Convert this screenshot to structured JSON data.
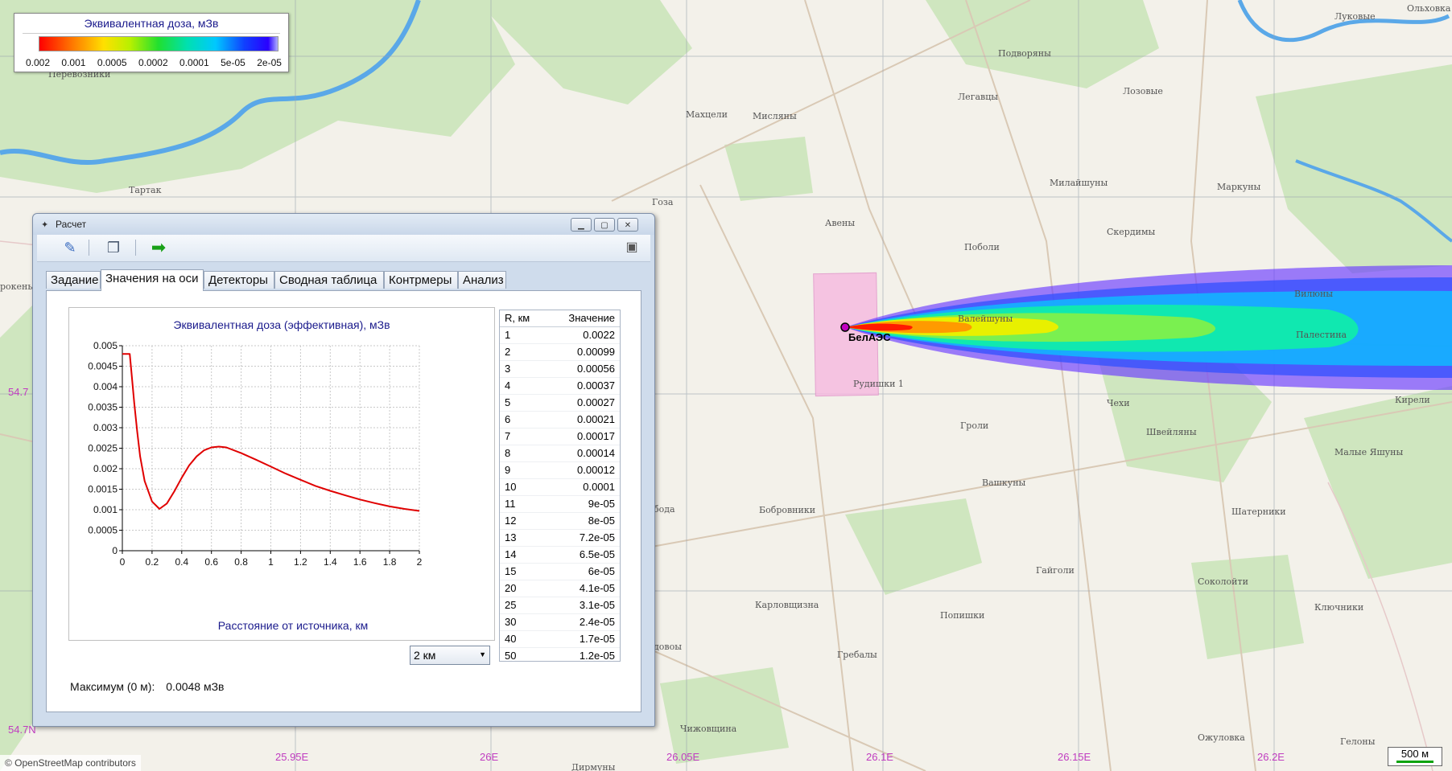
{
  "legend": {
    "title": "Эквивалентная доза, мЗв",
    "ticks": [
      "0.002",
      "0.001",
      "0.0005",
      "0.0002",
      "0.0001",
      "5e-05",
      "2e-05"
    ]
  },
  "map": {
    "source_label": "БелАЭС",
    "place_labels": [
      {
        "id": "podvoryany",
        "text": "Подворяны"
      },
      {
        "id": "lukovye",
        "text": "Луковые"
      },
      {
        "id": "olkovka",
        "text": "Ольховка"
      },
      {
        "id": "perevoznyki",
        "text": "Перевозники"
      },
      {
        "id": "mahcely",
        "text": "Махцели"
      },
      {
        "id": "mislyany",
        "text": "Мисляны"
      },
      {
        "id": "legavtsy",
        "text": "Легавцы"
      },
      {
        "id": "lozovye",
        "text": "Лозовые"
      },
      {
        "id": "milaishuny",
        "text": "Милайшуны"
      },
      {
        "id": "markuny",
        "text": "Маркуны"
      },
      {
        "id": "tartak",
        "text": "Тартак"
      },
      {
        "id": "goza",
        "text": "Гоза"
      },
      {
        "id": "aveny",
        "text": "Авены"
      },
      {
        "id": "poboli",
        "text": "Поболи"
      },
      {
        "id": "skerdimy",
        "text": "Скердимы"
      },
      {
        "id": "valeishuny",
        "text": "Валейшуны"
      },
      {
        "id": "vilnyuny",
        "text": "Вилюны"
      },
      {
        "id": "palestina",
        "text": "Палестина"
      },
      {
        "id": "rudishki",
        "text": "Рудишки 1"
      },
      {
        "id": "chehi",
        "text": "Чехи"
      },
      {
        "id": "groli",
        "text": "Гроли"
      },
      {
        "id": "shveilyany",
        "text": "Швейляны"
      },
      {
        "id": "kireli",
        "text": "Кирели"
      },
      {
        "id": "malye_yashuny",
        "text": "Малые Яшуны"
      },
      {
        "id": "vashkuny",
        "text": "Вашкуны"
      },
      {
        "id": "bobrovniki",
        "text": "Бобровники"
      },
      {
        "id": "shaterniki",
        "text": "Шатерники"
      },
      {
        "id": "gaigoli",
        "text": "Гайголи"
      },
      {
        "id": "sokoloity",
        "text": "Соколойти"
      },
      {
        "id": "karlovichizna",
        "text": "Карловщизна"
      },
      {
        "id": "popishki",
        "text": "Попишки"
      },
      {
        "id": "klyuchniki",
        "text": "Ключники"
      },
      {
        "id": "grebaly",
        "text": "Гребалы"
      },
      {
        "id": "chizhovshchina",
        "text": "Чижовщина"
      },
      {
        "id": "ozhulovka",
        "text": "Ожуловка"
      },
      {
        "id": "gelony",
        "text": "Гелоны"
      },
      {
        "id": "dirmuny",
        "text": "Дирмуны"
      },
      {
        "id": "rokenye",
        "text": "рокенье"
      },
      {
        "id": "boda",
        "text": "бода"
      },
      {
        "id": "dovoly",
        "text": "довоы"
      }
    ],
    "coords": {
      "lat1": "54.7",
      "lat2": "54.7N",
      "lon1": "25.95E",
      "lon2": "26E",
      "lon3": "26.05E",
      "lon4": "26.1E",
      "lon5": "26.15E",
      "lon6": "26.2E"
    },
    "attribution": "© OpenStreetMap contributors",
    "scale": "500 м"
  },
  "window": {
    "title": "Расчет",
    "tabs": [
      "Задание",
      "Значения на оси",
      "Детекторы",
      "Сводная таблица",
      "Контрмеры",
      "Анализ"
    ],
    "active_tab": "Значения на оси",
    "range_select": "2 км",
    "max_label": "Максимум (0 м):",
    "max_value": "0.0048 мЗв",
    "table": {
      "col_r": "R, км",
      "col_v": "Значение",
      "rows": [
        [
          "1",
          "0.0022"
        ],
        [
          "2",
          "0.00099"
        ],
        [
          "3",
          "0.00056"
        ],
        [
          "4",
          "0.00037"
        ],
        [
          "5",
          "0.00027"
        ],
        [
          "6",
          "0.00021"
        ],
        [
          "7",
          "0.00017"
        ],
        [
          "8",
          "0.00014"
        ],
        [
          "9",
          "0.00012"
        ],
        [
          "10",
          "0.0001"
        ],
        [
          "11",
          "9e-05"
        ],
        [
          "12",
          "8e-05"
        ],
        [
          "13",
          "7.2e-05"
        ],
        [
          "14",
          "6.5e-05"
        ],
        [
          "15",
          "6e-05"
        ],
        [
          "20",
          "4.1e-05"
        ],
        [
          "25",
          "3.1e-05"
        ],
        [
          "30",
          "2.4e-05"
        ],
        [
          "40",
          "1.7e-05"
        ],
        [
          "50",
          "1.2e-05"
        ]
      ]
    }
  },
  "chart_data": {
    "type": "line",
    "title": "Эквивалентная доза (эффективная), мЗв",
    "xlabel": "Расстояние от источника, км",
    "ylabel": "",
    "xlim": [
      0,
      2
    ],
    "ylim": [
      0,
      0.005
    ],
    "grid": true,
    "x_ticks": [
      "0",
      "0.2",
      "0.4",
      "0.6",
      "0.8",
      "1",
      "1.2",
      "1.4",
      "1.6",
      "1.8",
      "2"
    ],
    "y_ticks": [
      "0",
      "0.0005",
      "0.001",
      "0.0015",
      "0.002",
      "0.0025",
      "0.003",
      "0.0035",
      "0.004",
      "0.0045",
      "0.005"
    ],
    "series": [
      {
        "color": "#e00000",
        "x": [
          0,
          0.05,
          0.06,
          0.08,
          0.1,
          0.12,
          0.15,
          0.2,
          0.25,
          0.3,
          0.35,
          0.4,
          0.45,
          0.5,
          0.55,
          0.6,
          0.65,
          0.7,
          0.8,
          0.9,
          1.0,
          1.1,
          1.2,
          1.3,
          1.4,
          1.5,
          1.6,
          1.7,
          1.8,
          1.9,
          2.0
        ],
        "y": [
          0.0048,
          0.0048,
          0.0044,
          0.0036,
          0.0029,
          0.0023,
          0.0017,
          0.0012,
          0.00102,
          0.00115,
          0.00145,
          0.00178,
          0.00208,
          0.0023,
          0.00245,
          0.00252,
          0.00254,
          0.00252,
          0.00238,
          0.00222,
          0.00205,
          0.00188,
          0.00173,
          0.00158,
          0.00146,
          0.00135,
          0.00125,
          0.00116,
          0.00108,
          0.00102,
          0.00097
        ]
      }
    ]
  }
}
